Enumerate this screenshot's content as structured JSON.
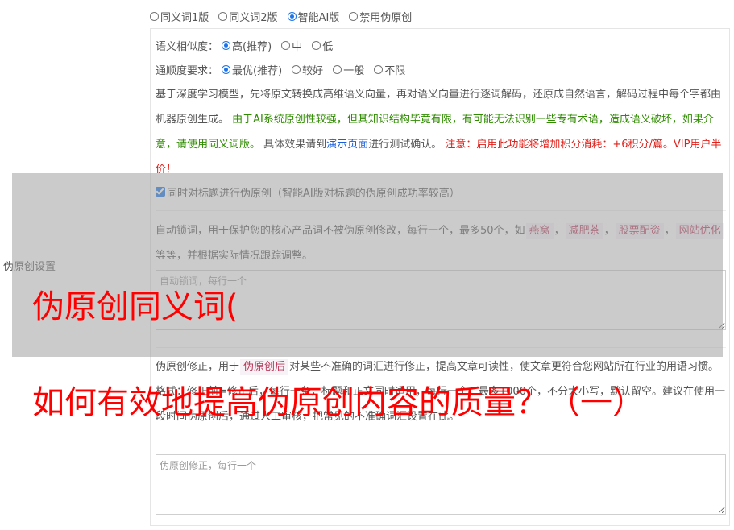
{
  "mode": {
    "options": [
      "同义词1版",
      "同义词2版",
      "智能AI版",
      "禁用伪原创"
    ],
    "selected_index": 2
  },
  "similarity": {
    "label": "语义相似度：",
    "options": [
      "高(推荐)",
      "中",
      "低"
    ],
    "selected_index": 0
  },
  "fluency": {
    "label": "通顺度要求：",
    "options": [
      "最优(推荐)",
      "较好",
      "一般",
      "不限"
    ],
    "selected_index": 0
  },
  "ai_desc": {
    "part1": "基于深度学习模型，先将原文转换成高维语义向量，再对语义向量进行逐词解码，还原成自然语言，解码过程中每个字都由机器原创生成。",
    "warning_green": "由于AI系统原创性较强，但其知识结构毕竟有限，有可能无法识别一些专有术语，造成语义破坏，如果介意，请使用同义词版。",
    "part2": "具体效果请到",
    "demo_link": "演示页面",
    "part3": "进行测试确认。",
    "warning_red": "注意：启用此功能将增加积分消耗：+6积分/篇。VIP用户半价！"
  },
  "title_checkbox": {
    "label": "同时对标题进行伪原创（智能AI版对标题的伪原创成功率较高）",
    "checked": true
  },
  "lock_words": {
    "desc_part1": "自动锁词，用于保护您的核心产品词不被伪原创修改，每行一个，最多50个，如",
    "examples": [
      "燕窝",
      "减肥茶",
      "股票配资",
      "网站优化"
    ],
    "desc_part2": "等等，并根据实际情况跟踪调整。",
    "placeholder": "自动锁词，每行一个"
  },
  "side_label": "伪原创设置",
  "correction": {
    "desc_part1": "伪原创修正，用于",
    "tag": "伪原创后",
    "desc_part2": "对某些不准确的词汇进行修正，提高文章可读性，使文章更符合您网站所在行业的用语习惯。格式：修正前=修正后，每行一条，标题和正文同时适用，每行一个，最多1000个，不分大小写，默认留空。建议在使用一段时间伪原创后，通过人工审核，把常见的不准确词汇设置在此。",
    "placeholder": "伪原创修正，每行一个"
  },
  "overlay": {
    "line1": "伪原创同义词(",
    "line2": "如何有效地提高伪原创内容的质量？（一）"
  },
  "colors": {
    "accent": "#1a73e8",
    "warning_green": "#2f8c00",
    "warning_red": "#e0201a",
    "overlay_text": "#ff0000"
  }
}
